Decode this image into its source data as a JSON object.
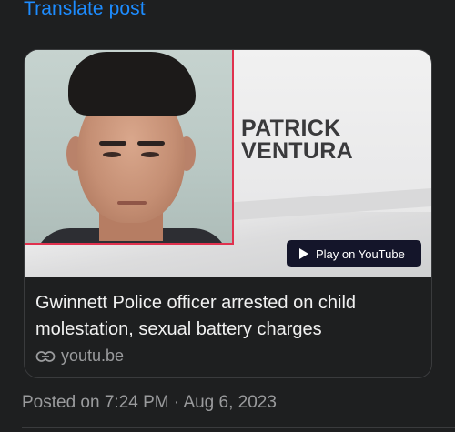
{
  "translate_label": "Translate post",
  "card": {
    "thumbnail": {
      "name_lines": [
        "PATRICK",
        "VENTURA"
      ],
      "play_label": "Play on YouTube"
    },
    "title": "Gwinnett Police officer arrested on child molestation, sexual battery charges",
    "domain": "youtu.be"
  },
  "posted": "Posted on 7:24 PM · Aug 6, 2023",
  "colors": {
    "link_blue": "#1d8cff",
    "background": "#1e1f20",
    "mugshot_border": "#e0314e"
  }
}
